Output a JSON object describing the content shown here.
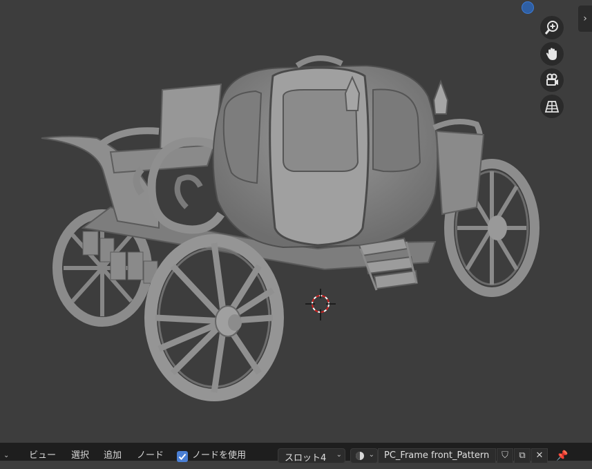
{
  "viewport": {
    "nav_icons": [
      "zoom-icon",
      "hand-pan-icon",
      "camera-icon",
      "perspective-grid-icon"
    ],
    "accent_color": "#4a7fd4"
  },
  "header": {
    "menu_view": "ビュー",
    "menu_select": "選択",
    "menu_add": "追加",
    "menu_node": "ノード",
    "use_nodes_label": "ノードを使用",
    "use_nodes_checked": true,
    "slot_label": "スロット4",
    "material_name": "PC_Frame front_Pattern"
  }
}
